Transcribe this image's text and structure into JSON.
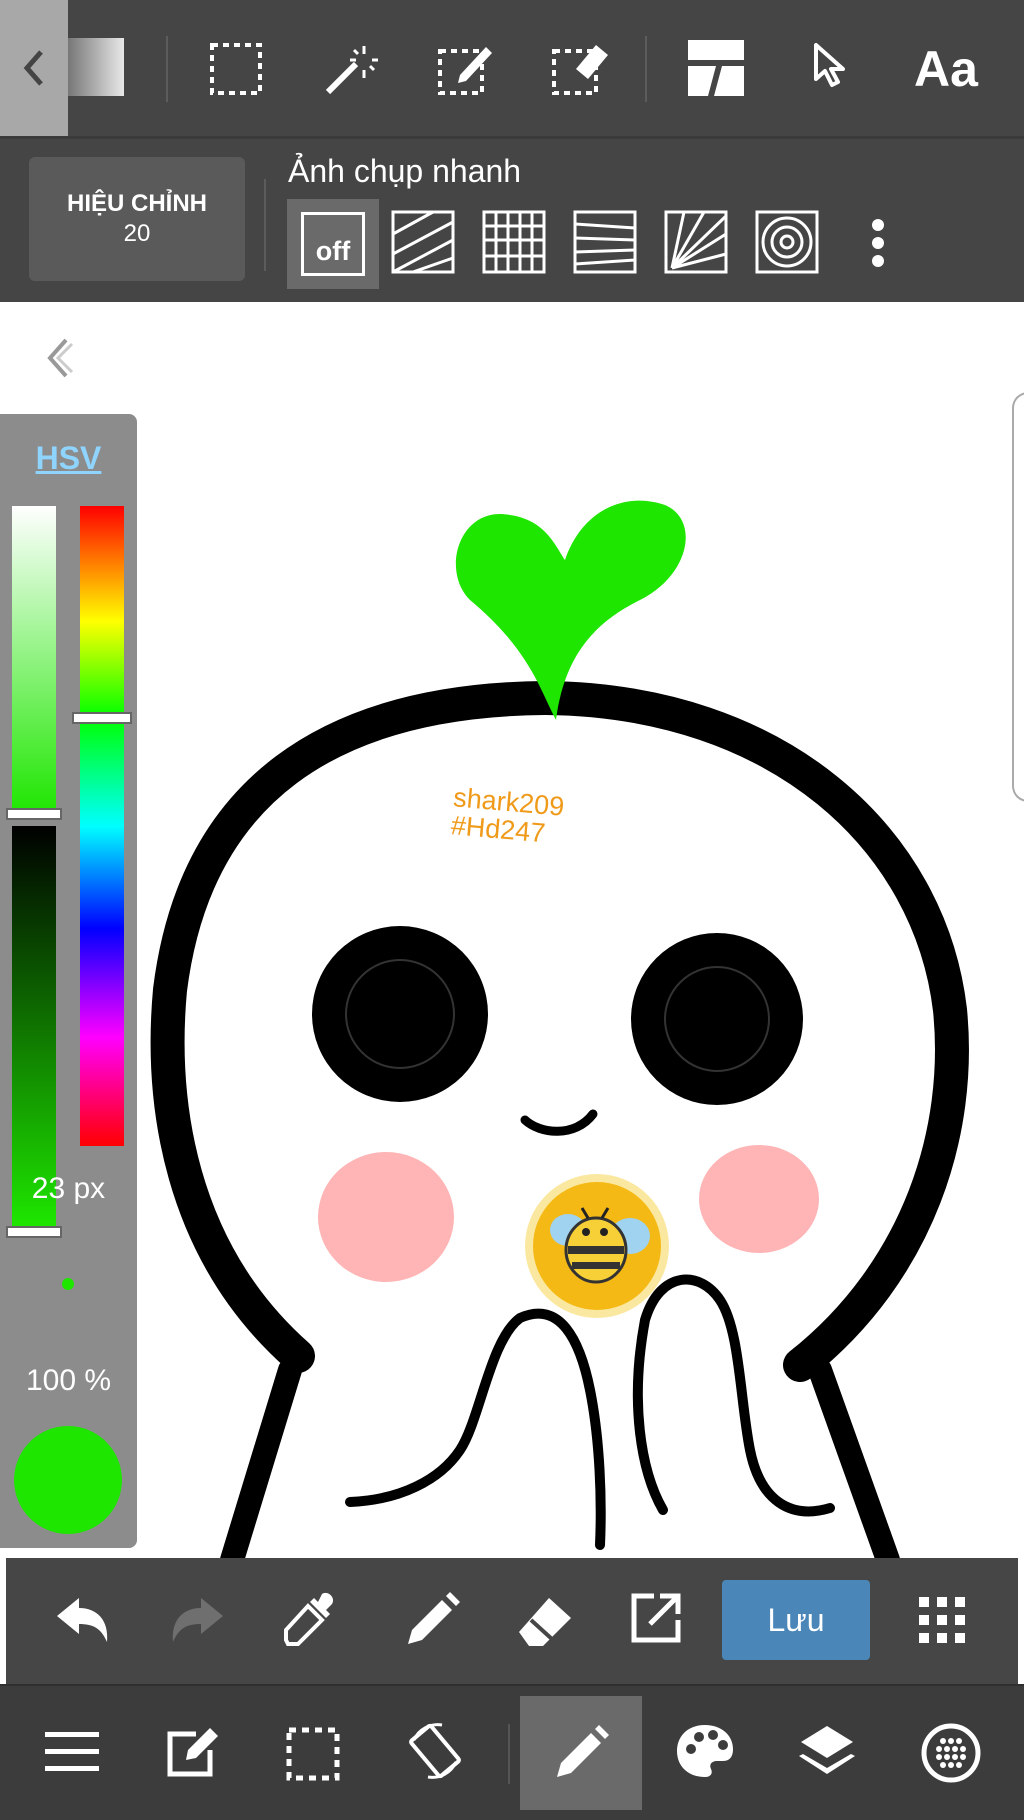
{
  "toolbar": {
    "tools": [
      "back-chevron-icon",
      "gradient-icon",
      "select-rect-icon",
      "magic-wand-icon",
      "select-pen-icon",
      "select-eraser-icon",
      "frame-divider-icon",
      "move-cursor-icon",
      "text-tool-icon"
    ],
    "text_tool_label": "Aa"
  },
  "snap": {
    "correction_label": "HIỆU CHỈNH",
    "correction_value": "20",
    "title": "Ảnh chụp nhanh",
    "off_label": "off",
    "options": [
      "snap-off",
      "snap-parallel",
      "snap-grid",
      "snap-perspective",
      "snap-radial",
      "snap-concentric"
    ]
  },
  "color_panel": {
    "mode_label": "HSV",
    "brush_size": "23 px",
    "opacity": "100 %",
    "current_color": "#1ee600",
    "saturation_level": 0.44,
    "value_level": 1.0,
    "hue_level": 0.33
  },
  "artwork": {
    "watermark_line1": "shark209",
    "watermark_line2": "#Hd247"
  },
  "bottom_toolbar": {
    "save_label": "Lưu",
    "items": [
      "undo-icon",
      "redo-icon",
      "eyedropper-icon",
      "pen-icon",
      "eraser-icon",
      "export-icon",
      "save-button",
      "grid-menu-icon"
    ]
  },
  "nav_bar": {
    "items": [
      "menu-icon",
      "edit-icon",
      "selection-icon",
      "rotate-icon",
      "brush-icon",
      "palette-icon",
      "layers-icon",
      "material-icon"
    ],
    "active": "brush-icon"
  },
  "colors": {
    "toolbar_bg": "#454545",
    "accent_save": "#4a87b8",
    "leaf_green": "#1ee600",
    "cheek_pink": "#ffb5b5",
    "watermark_orange": "#f09a1a"
  }
}
